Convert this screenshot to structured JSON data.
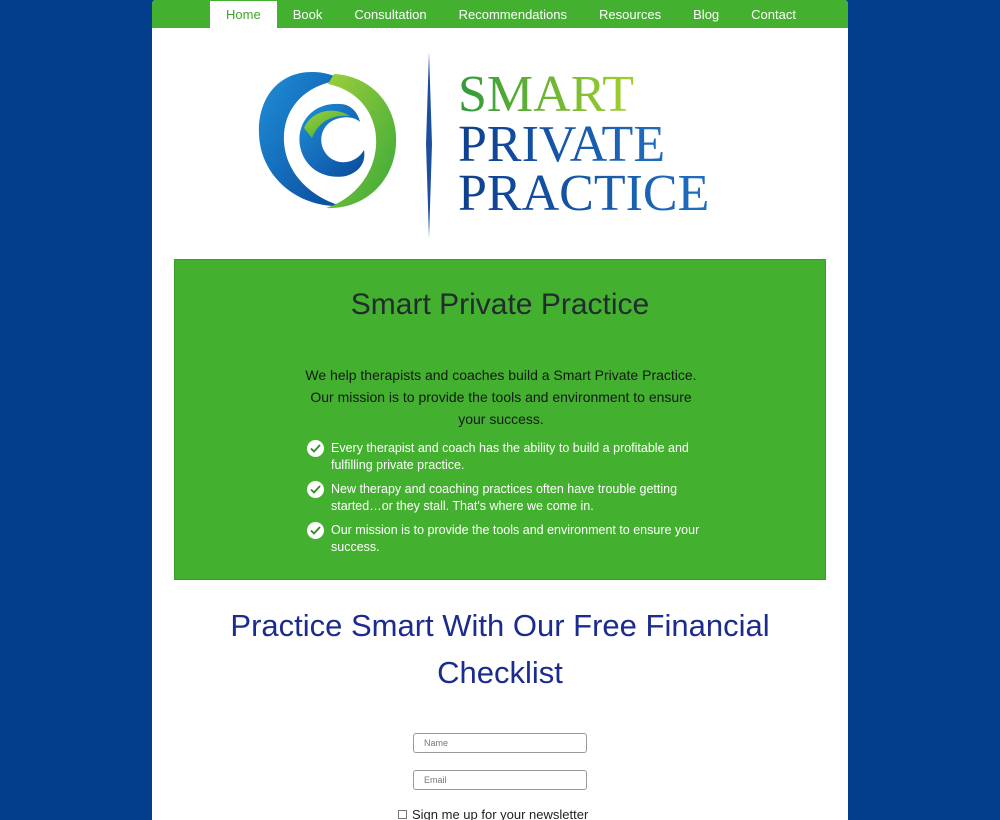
{
  "nav": {
    "items": [
      {
        "label": "Home",
        "active": true
      },
      {
        "label": "Book"
      },
      {
        "label": "Consultation"
      },
      {
        "label": "Recommendations"
      },
      {
        "label": "Resources"
      },
      {
        "label": "Blog"
      },
      {
        "label": "Contact"
      }
    ]
  },
  "logo": {
    "line1": "SMART",
    "line2": "PRIVATE",
    "line3": "PRACTICE"
  },
  "hero": {
    "title": "Smart Private Practice",
    "intro": "We help therapists and coaches build a Smart Private Practice. Our mission is to provide the tools and environment to ensure your success.",
    "points": [
      "Every therapist and coach has the ability to build a profitable and fulfilling private practice.",
      "New therapy and coaching practices often have trouble getting started…or they stall. That's where we come in.",
      "Our mission is to provide the tools and environment to ensure your success."
    ]
  },
  "cta": {
    "heading": "Practice Smart With Our Free Financial Checklist"
  },
  "form": {
    "name_placeholder": "Name",
    "email_placeholder": "Email",
    "newsletter_label": "Sign me up for your newsletter"
  },
  "colors": {
    "background": "#033e8c",
    "nav_green": "#44b02f",
    "hero_green": "#44b02f",
    "heading_blue": "#1b2b8f"
  }
}
